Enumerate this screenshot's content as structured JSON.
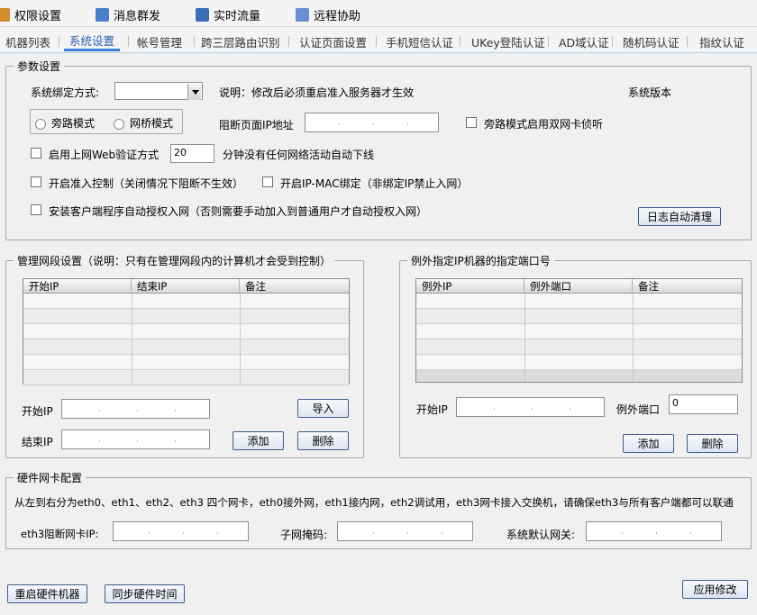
{
  "toolbar": [
    {
      "label": "权限设置",
      "icon": "permission-icon",
      "color": "#d28a2a"
    },
    {
      "label": "消息群发",
      "icon": "message-icon",
      "color": "#4a7fc8"
    },
    {
      "label": "实时流量",
      "icon": "monitor-icon",
      "color": "#3a6db5"
    },
    {
      "label": "远程协助",
      "icon": "remote-icon",
      "color": "#6a8fd0"
    }
  ],
  "tabs": [
    "机器列表",
    "系统设置",
    "帐号管理",
    "跨三层路由识别",
    "认证页面设置",
    "手机短信认证",
    "UKey登陆认证",
    "AD域认证",
    "随机码认证",
    "指纹认证"
  ],
  "active_tab": "系统设置",
  "params": {
    "legend": "参数设置",
    "bind_label": "系统绑定方式:",
    "bind_value": "",
    "note": "说明：修改后必须重启准入服务器才生效",
    "version_label": "系统版本",
    "mode_bypass": "旁路模式",
    "mode_bridge": "网桥模式",
    "block_ip_label": "阻断页面IP地址",
    "dual_nic": "旁路模式启用双网卡侦听",
    "web_auth": "启用上网Web验证方式",
    "web_auth_minutes": "20",
    "web_auth_suffix": "分钟没有任何网络活动自动下线",
    "access_control": "开启准入控制（关闭情况下阻断不生效）",
    "ip_mac_bind": "开启IP-MAC绑定（非绑定IP禁止入网）",
    "auto_auth": "安装客户端程序自动授权入网（否则需要手动加入到普通用户才自动授权入网）",
    "log_clean": "日志自动清理"
  },
  "manage": {
    "legend": "管理网段设置（说明：只有在管理网段内的计算机才会受到控制）",
    "columns": [
      "开始IP",
      "结束IP",
      "备注"
    ],
    "start_ip_label": "开始IP",
    "end_ip_label": "结束IP",
    "import": "导入",
    "add": "添加",
    "delete": "删除"
  },
  "exception": {
    "legend": "例外指定IP机器的指定端口号",
    "columns": [
      "例外IP",
      "例外端口",
      "备注"
    ],
    "ip_label": "开始IP",
    "port_label": "例外端口",
    "port_value": "0",
    "add": "添加",
    "delete": "删除"
  },
  "hardware": {
    "legend": "硬件网卡配置",
    "desc": "从左到右分为eth0、eth1、eth2、eth3 四个网卡，eth0接外网，eth1接内网，eth2调试用，eth3网卡接入交换机，请确保eth3与所有客户端都可以联通",
    "eth3_ip_label": "eth3阻断网卡IP:",
    "mask_label": "子网掩码:",
    "gateway_label": "系统默认网关:"
  },
  "footer": {
    "reboot": "重启硬件机器",
    "sync_time": "同步硬件时间",
    "apply": "应用修改"
  },
  "ip_dot": "·"
}
